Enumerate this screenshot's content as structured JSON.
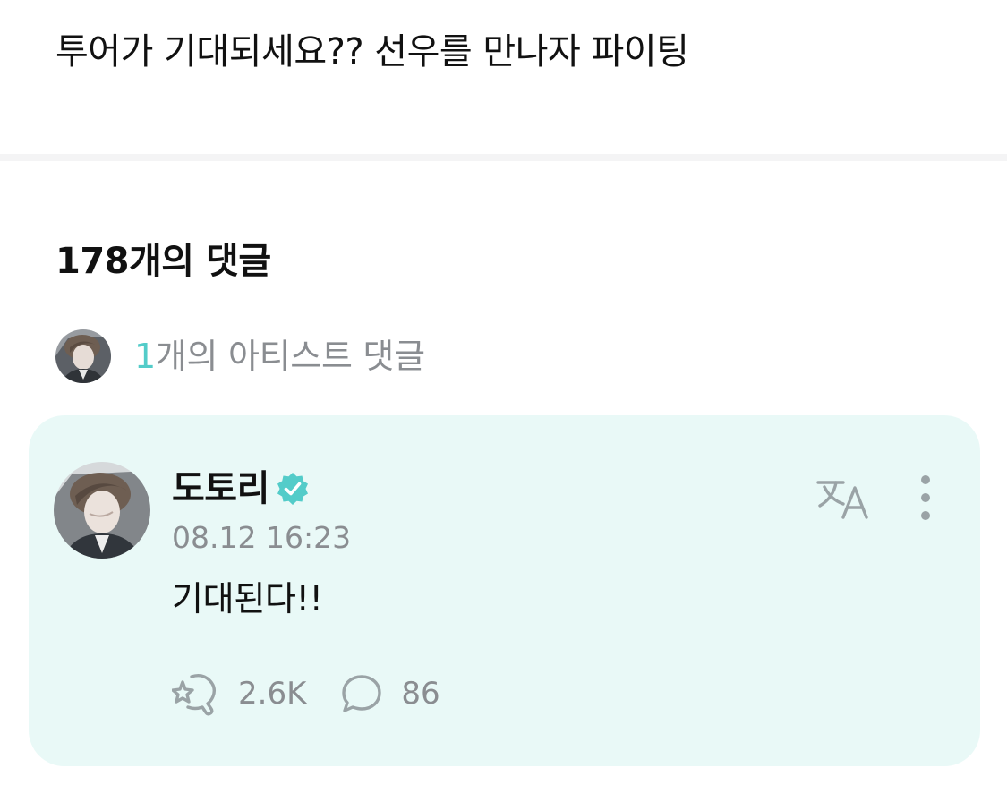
{
  "post": {
    "text": "투어가 기대되세요?? 선우를 만나자 파이팅"
  },
  "comments_section": {
    "heading": "178개의 댓글",
    "artist_summary": {
      "count": "1",
      "label": "개의 아티스트 댓글",
      "avatar_icon": "artist-avatar"
    }
  },
  "artist_comment": {
    "author": "도토리",
    "verified_icon": "verified-badge-icon",
    "timestamp": "08.12 16:23",
    "text": "기대된다!!",
    "like_count": "2.6K",
    "reply_count": "86",
    "icons": {
      "translate": "translate-icon",
      "more": "more-vertical-icon",
      "like": "like-reaction-icon",
      "reply": "reply-bubble-icon"
    }
  },
  "colors": {
    "card_background": "#e9f9f7",
    "accent": "#53ccc9",
    "muted_text": "#8a8d91",
    "icon_gray": "#9aa3a6",
    "divider": "#f4f4f5"
  }
}
